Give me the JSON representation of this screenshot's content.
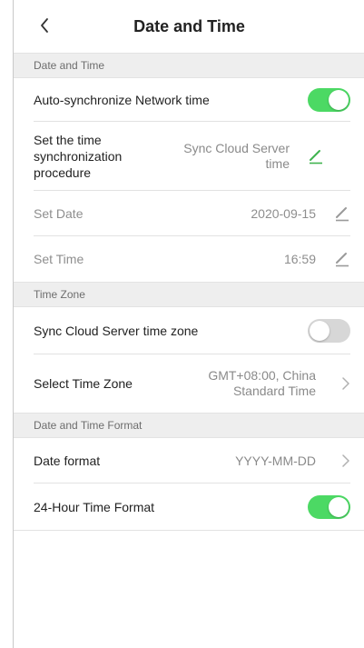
{
  "header": {
    "title": "Date and Time",
    "back_icon": "chevron-left-icon"
  },
  "sections": {
    "date_time": "Date and Time",
    "time_zone": "Time Zone",
    "format": "Date and Time Format"
  },
  "rows": {
    "auto_sync": {
      "label": "Auto-synchronize Network time",
      "enabled": true
    },
    "sync_procedure": {
      "label": "Set the time synchronization procedure",
      "value": "Sync Cloud Server time",
      "icon": "edit-icon"
    },
    "set_date": {
      "label": "Set Date",
      "value": "2020-09-15",
      "icon": "edit-icon"
    },
    "set_time": {
      "label": "Set Time",
      "value": "16:59",
      "icon": "edit-icon"
    },
    "sync_tz": {
      "label": "Sync Cloud Server time zone",
      "enabled": false
    },
    "select_tz": {
      "label": "Select Time Zone",
      "value": "GMT+08:00, China Standard Time",
      "icon": "chevron-right-icon"
    },
    "date_format": {
      "label": "Date format",
      "value": "YYYY-MM-DD",
      "icon": "chevron-right-icon"
    },
    "hour24": {
      "label": "24-Hour Time Format",
      "enabled": true
    }
  },
  "colors": {
    "toggle_on": "#4cd964",
    "toggle_off": "#d7d7d7",
    "edit_active": "#3fb34f",
    "edit_disabled": "#9a9a9a"
  }
}
